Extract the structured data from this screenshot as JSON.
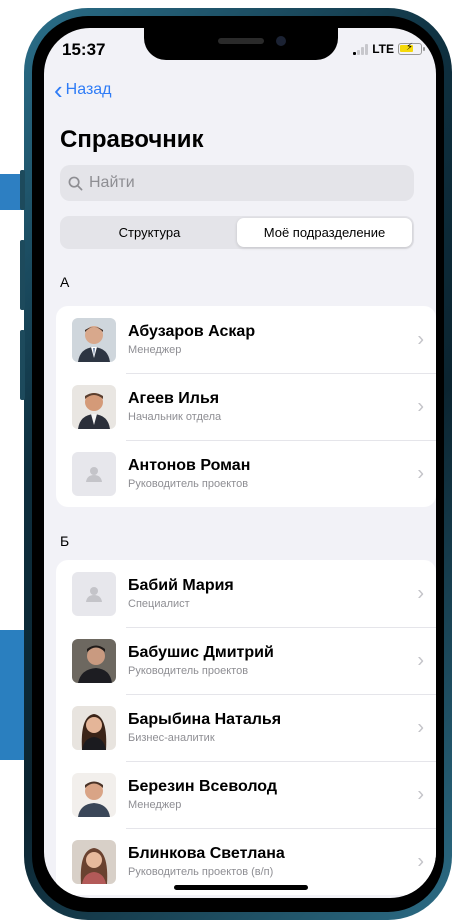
{
  "status_bar": {
    "time": "15:37",
    "network": "LTE"
  },
  "nav": {
    "back_label": "Назад",
    "title": "Справочник"
  },
  "search": {
    "placeholder": "Найти"
  },
  "segments": {
    "structure": "Структура",
    "my_department": "Моё подразделение"
  },
  "sections": [
    {
      "letter": "А",
      "contacts": [
        {
          "name": "Абузаров Аскар",
          "role": "Менеджер"
        },
        {
          "name": "Агеев Илья",
          "role": "Начальник отдела"
        },
        {
          "name": "Антонов Роман",
          "role": "Руководитель проектов"
        }
      ]
    },
    {
      "letter": "Б",
      "contacts": [
        {
          "name": "Бабий Мария",
          "role": "Специалист"
        },
        {
          "name": "Бабушис Дмитрий",
          "role": "Руководитель проектов"
        },
        {
          "name": "Барыбина Наталья",
          "role": "Бизнес-аналитик"
        },
        {
          "name": "Березин Всеволод",
          "role": "Менеджер"
        },
        {
          "name": "Блинкова Светлана",
          "role": "Руководитель проектов (в/п)"
        }
      ]
    }
  ],
  "colors": {
    "accent": "#2f7cf6",
    "brand_bar": "#2d7fc2"
  }
}
